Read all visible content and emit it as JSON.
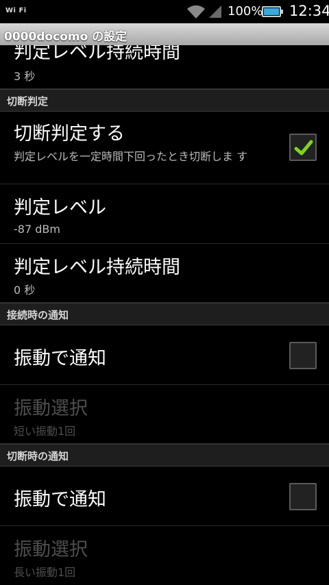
{
  "status_bar": {
    "wifi_badge": "Wi Fi",
    "battery_text": "100%",
    "time": "12:34",
    "battery_color": "#39a9dc"
  },
  "title_bar": {
    "title": "0000docomo の設定"
  },
  "list": {
    "prev_item": {
      "title": "判定レベル持続時間",
      "summary": "3 秒"
    },
    "section_cut": {
      "label": "切断判定"
    },
    "cut_enable": {
      "title": "切断判定する",
      "summary": "判定レベルを一定時間下回ったとき切断しま す",
      "checked": true
    },
    "cut_level": {
      "title": "判定レベル",
      "summary": "-87 dBm"
    },
    "cut_duration": {
      "title": "判定レベル持続時間",
      "summary": "0 秒"
    },
    "section_connect_notify": {
      "label": "接続時の通知"
    },
    "connect_vibrate": {
      "title": "振動で通知",
      "checked": false
    },
    "connect_vibrate_select": {
      "title": "振動選択",
      "summary": "短い振動1回",
      "enabled": false
    },
    "section_disconnect_notify": {
      "label": "切断時の通知"
    },
    "disconnect_vibrate": {
      "title": "振動で通知",
      "checked": false
    },
    "disconnect_vibrate_select": {
      "title": "振動選択",
      "summary": "長い振動1回",
      "enabled": false
    }
  },
  "colors": {
    "check_mark": "#7fd321",
    "section_bg": "#1e1e1e"
  }
}
